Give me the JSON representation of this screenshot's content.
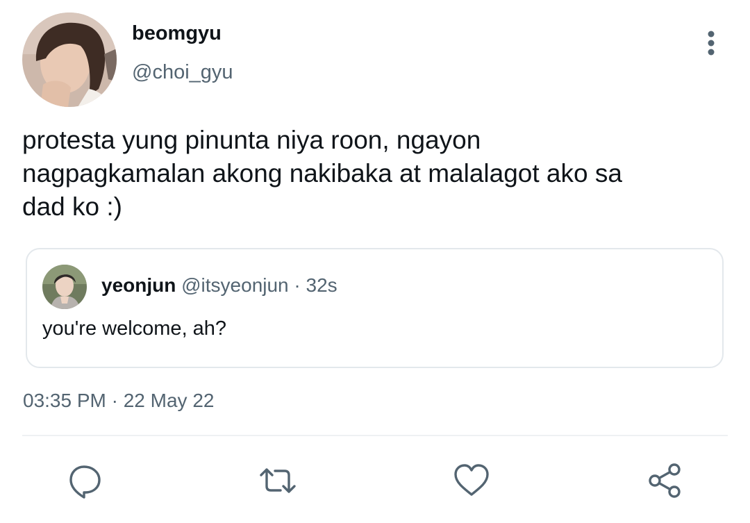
{
  "author": {
    "display_name": "beomgyu",
    "handle": "@choi_gyu",
    "avatar_icon": "user-avatar-photo"
  },
  "tweet": {
    "text_lines": [
      "protesta yung pinunta niya roon, ngayon",
      "nagpagkamalan akong nakibaka at malalagot ako sa",
      "dad ko :)"
    ],
    "timestamp": "03:35 PM · 22 May 22"
  },
  "quote": {
    "display_name": "yeonjun",
    "handle": "@itsyeonjun",
    "separator": "·",
    "time": "32s",
    "text": "you're welcome, ah?",
    "avatar_icon": "user-avatar-photo"
  },
  "actions": [
    {
      "name": "reply",
      "icon": "reply-bubble-icon"
    },
    {
      "name": "retweet",
      "icon": "retweet-icon"
    },
    {
      "name": "like",
      "icon": "heart-icon"
    },
    {
      "name": "share",
      "icon": "share-icon"
    }
  ],
  "colors": {
    "text_primary": "#0f1419",
    "text_secondary": "#536471",
    "border": "#e3e8ec",
    "divider": "#eef1f3"
  }
}
